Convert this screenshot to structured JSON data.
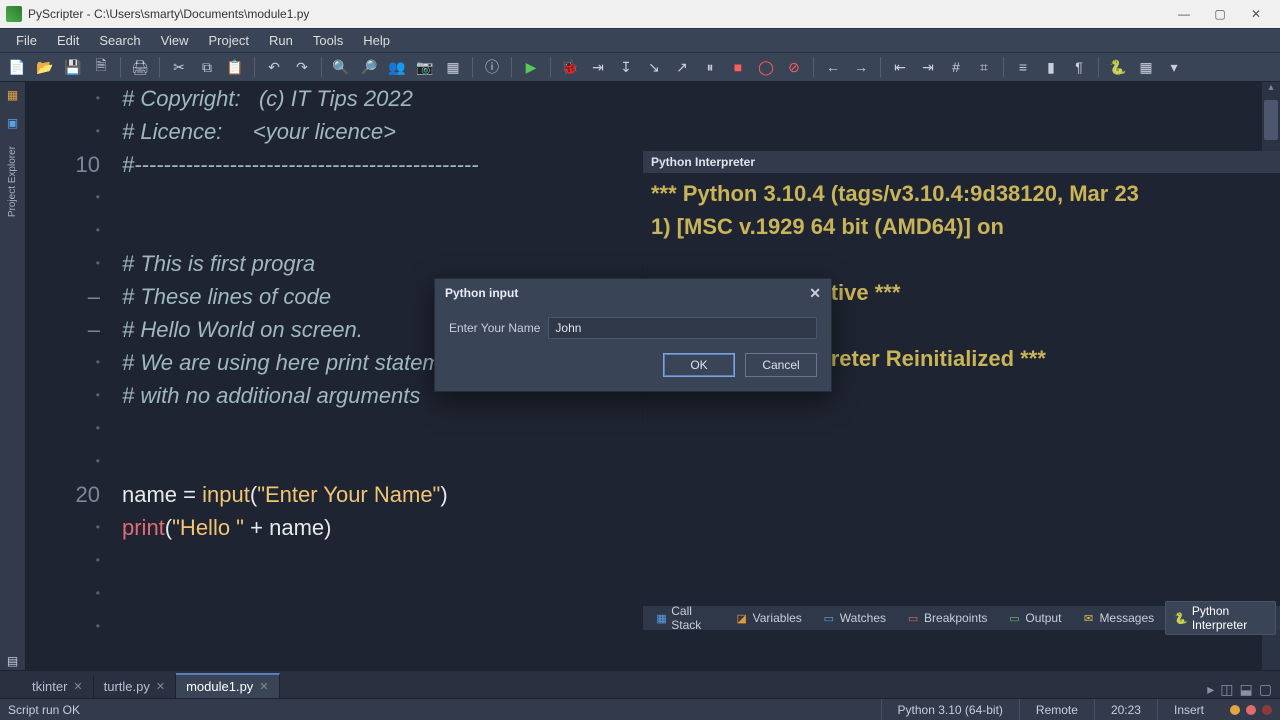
{
  "window": {
    "title": "PyScripter - C:\\Users\\smarty\\Documents\\module1.py"
  },
  "menu": [
    "File",
    "Edit",
    "Search",
    "View",
    "Project",
    "Run",
    "Tools",
    "Help"
  ],
  "sidebar": {
    "label": "Project Explorer"
  },
  "editor": {
    "lines": [
      {
        "num": "",
        "marker": "·",
        "html": "<span class='cmt'># Copyright:   (c) IT Tips 2022</span>"
      },
      {
        "num": "",
        "marker": "·",
        "html": "<span class='cmt'># Licence:     &lt;your licence&gt;</span>"
      },
      {
        "num": "10",
        "marker": "",
        "html": "<span class='cmt'>#-----------------------------------------------</span>"
      },
      {
        "num": "",
        "marker": "·",
        "html": ""
      },
      {
        "num": "",
        "marker": "·",
        "html": ""
      },
      {
        "num": "",
        "marker": "·",
        "html": "<span class='cmt'># This is first progra</span>"
      },
      {
        "num": "",
        "marker": "–",
        "html": "<span class='cmt'># These lines of code</span>"
      },
      {
        "num": "",
        "marker": "–",
        "html": "<span class='cmt'># Hello World on screen.</span>"
      },
      {
        "num": "",
        "marker": "·",
        "html": "<span class='cmt'># We are using here print statement</span>"
      },
      {
        "num": "",
        "marker": "·",
        "html": "<span class='cmt'># with no additional arguments</span>"
      },
      {
        "num": "",
        "marker": "·",
        "html": ""
      },
      {
        "num": "",
        "marker": "·",
        "html": ""
      },
      {
        "num": "20",
        "marker": "",
        "html": "<span class='name'>name</span> <span class='eq'>=</span> <span class='fn2'>input</span><span class='paren'>(</span><span class='str'>\"Enter Your Name\"</span><span class='paren'>)</span>"
      },
      {
        "num": "",
        "marker": "·",
        "html": "<span class='fn'>print</span><span class='paren'>(</span><span class='str'>\"Hello \"</span> <span class='eq'>+</span> <span class='name'>name</span><span class='paren'>)</span>"
      },
      {
        "num": "",
        "marker": "·",
        "html": ""
      },
      {
        "num": "",
        "marker": "·",
        "html": ""
      },
      {
        "num": "",
        "marker": "·",
        "html": ""
      }
    ]
  },
  "interpreter": {
    "title": "Python Interpreter",
    "lines": [
      "*** Python 3.10.4 (tags/v3.10.4:9d38120, Mar 23",
      "1) [MSC v.1929 64 bit (AMD64)] on",
      "",
      "thon engine is active ***",
      ">>>",
      "*** Remote Interpreter Reinitialized ***"
    ]
  },
  "bottom_tabs": [
    {
      "label": "Call Stack",
      "icon": "▦",
      "color": "#5aa0e6"
    },
    {
      "label": "Variables",
      "icon": "◪",
      "color": "#e29a3f"
    },
    {
      "label": "Watches",
      "icon": "▭",
      "color": "#5aa0e6"
    },
    {
      "label": "Breakpoints",
      "icon": "▭",
      "color": "#e06c6c"
    },
    {
      "label": "Output",
      "icon": "▭",
      "color": "#6abf6a"
    },
    {
      "label": "Messages",
      "icon": "✉",
      "color": "#e2c24d"
    },
    {
      "label": "Python Interpreter",
      "icon": "🐍",
      "color": "#5aa0e6",
      "active": true
    }
  ],
  "file_tabs": [
    {
      "label": "tkinter",
      "active": false
    },
    {
      "label": "turtle.py",
      "active": false
    },
    {
      "label": "module1.py",
      "active": true
    }
  ],
  "status": {
    "left": "Script run OK",
    "python": "Python 3.10 (64-bit)",
    "mode": "Remote",
    "pos": "20:23",
    "ins": "Insert"
  },
  "dialog": {
    "title": "Python input",
    "label": "Enter Your Name",
    "value": "John",
    "ok": "OK",
    "cancel": "Cancel"
  }
}
